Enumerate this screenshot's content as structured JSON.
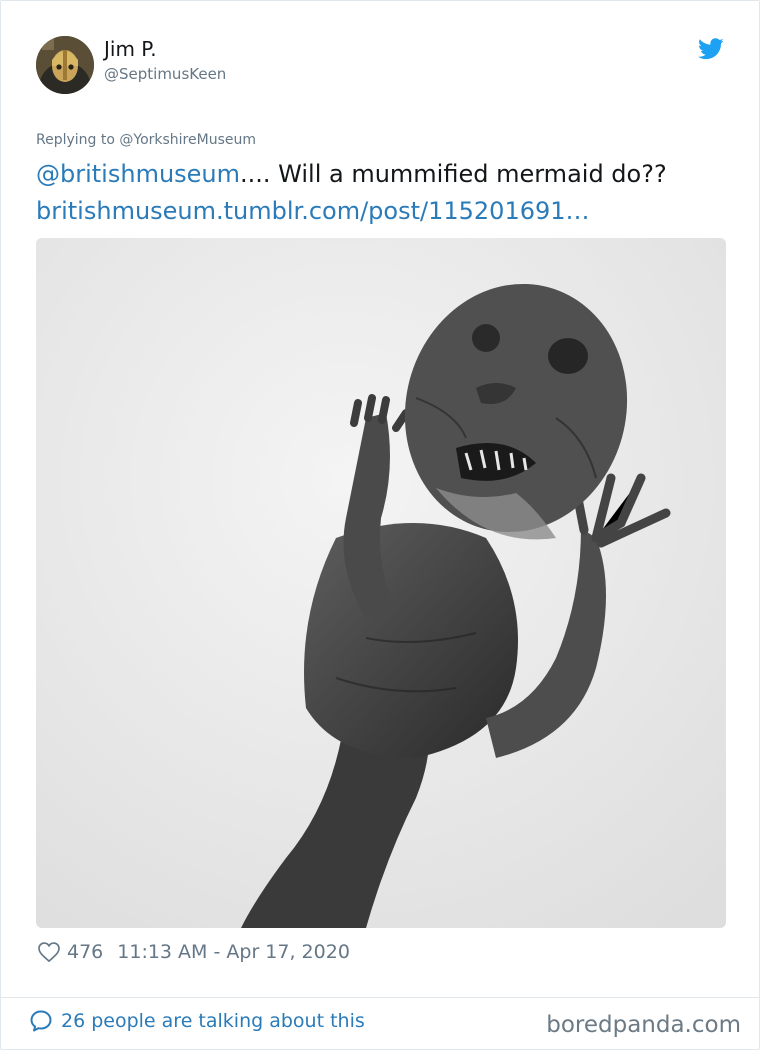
{
  "tweet": {
    "author": {
      "name": "Jim P.",
      "handle": "@SeptimusKeen"
    },
    "replying_to": "Replying to @YorkshireMuseum",
    "text_mention": "@britishmuseum",
    "text_body": ".... Will a mummified mermaid do??",
    "text_link": "britishmuseum.tumblr.com/post/115201691…",
    "likes": "476",
    "timestamp": "11:13 AM - Apr 17, 2020",
    "talking": "26 people are talking about this"
  },
  "watermark": "boredpanda.com",
  "icons": {
    "brand": "twitter-bird-icon",
    "like": "heart-icon",
    "reply": "speech-bubble-icon"
  },
  "colors": {
    "link": "#2b7bb9",
    "secondary_text": "#657786",
    "brand_blue": "#1da1f2"
  }
}
